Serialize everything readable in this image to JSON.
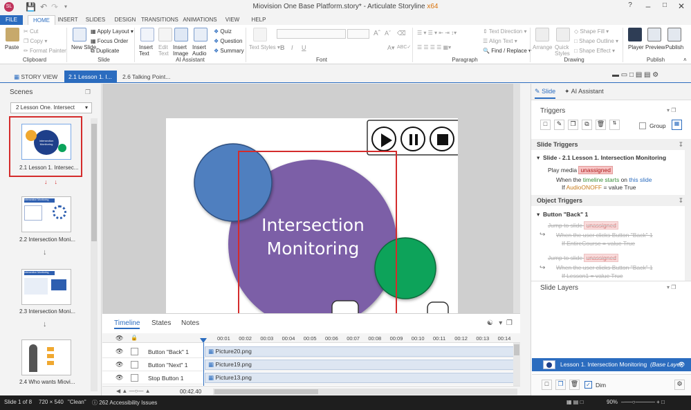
{
  "window": {
    "title_prefix": "Miovision One Base Platform.story* - Articulate Storyline",
    "title_arch": "x64"
  },
  "menu_tabs": [
    "FILE",
    "HOME",
    "INSERT",
    "SLIDES",
    "DESIGN",
    "TRANSITIONS",
    "ANIMATIONS",
    "VIEW",
    "HELP"
  ],
  "ribbon": {
    "clipboard": {
      "paste": "Paste",
      "cut": "Cut",
      "copy": "Copy",
      "format_painter": "Format Painter",
      "group": "Clipboard"
    },
    "slide": {
      "new_slide": "New Slide",
      "apply_layout": "Apply Layout",
      "focus_order": "Focus Order",
      "duplicate": "Duplicate",
      "group": "Slide"
    },
    "ai": {
      "insert_text": "Insert Text",
      "edit_text": "Edit Text",
      "insert_image": "Insert Image",
      "insert_audio": "Insert Audio",
      "quiz": "Quiz",
      "question": "Question",
      "summary": "Summary",
      "group": "AI Assistant"
    },
    "font": {
      "text_styles": "Text Styles",
      "group": "Font",
      "bold": "B",
      "italic": "I",
      "underline": "U"
    },
    "paragraph": {
      "text_direction": "Text Direction",
      "align_text": "Align Text",
      "find_replace": "Find / Replace",
      "group": "Paragraph"
    },
    "drawing": {
      "arrange": "Arrange",
      "quick_styles": "Quick Styles",
      "shape_fill": "Shape Fill",
      "shape_outline": "Shape Outline",
      "shape_effect": "Shape Effect",
      "group": "Drawing"
    },
    "publish": {
      "player": "Player",
      "preview": "Preview",
      "publish": "Publish",
      "group": "Publish"
    }
  },
  "doc_tabs": {
    "story_view": "STORY VIEW",
    "active": "2.1 Lesson 1. I...",
    "other": "2.6 Talking Point..."
  },
  "scenes": {
    "title": "Scenes",
    "dropdown": "2 Lesson One. Intersect",
    "slides": [
      {
        "caption": "2.1 Lesson 1. Intersec...",
        "thumb_title": "Intersection Monitoring"
      },
      {
        "caption": "2.2 Intersection Moni...",
        "thumb_title": "Intersection Monitoring"
      },
      {
        "caption": "2.3 Intersection Moni...",
        "thumb_title": "Intersection Monitoring"
      },
      {
        "caption": "2.4 Who wants Miovi...",
        "thumb_title": ""
      }
    ]
  },
  "slide_canvas": {
    "circle_text_line1": "Intersection",
    "circle_text_line2": "Monitoring",
    "colors": {
      "purple": "#7b5ea7",
      "blue": "#4f7fbf",
      "green": "#0aa35a",
      "orange": "#f0a830",
      "highlight": "#d42b2b"
    }
  },
  "timeline": {
    "tabs": [
      "Timeline",
      "States",
      "Notes"
    ],
    "ticks": [
      "00:01",
      "00:02",
      "00:03",
      "00:04",
      "00:05",
      "00:06",
      "00:07",
      "00:08",
      "00:09",
      "00:10",
      "00:11",
      "00:12",
      "00:13",
      "00:14"
    ],
    "rows": [
      {
        "name": "Button \"Back\" 1",
        "asset": "Picture20.png"
      },
      {
        "name": "Button \"Next\" 1",
        "asset": "Picture19.png"
      },
      {
        "name": "Stop Button 1",
        "asset": "Picture13.png"
      }
    ],
    "duration": "00:42.40"
  },
  "right_panel": {
    "tabs": {
      "slide": "Slide",
      "ai": "AI Assistant"
    },
    "triggers_title": "Triggers",
    "group_label": "Group",
    "slide_triggers_title": "Slide Triggers",
    "slide_trigger_group": "Slide - 2.1 Lesson 1. Intersection Monitoring",
    "slide_trigger": {
      "action": "Play media",
      "target": "unassigned",
      "when_prefix": "When the",
      "when_event": "timeline starts",
      "when_on": "on",
      "when_target": "this slide",
      "if_prefix": "If",
      "if_var": "AudioONOFF",
      "if_cond": "= value True"
    },
    "object_triggers_title": "Object Triggers",
    "object_group": "Button \"Back\" 1",
    "object_triggers": [
      {
        "action": "Jump to slide",
        "target": "unassigned",
        "when": "When the user clicks Button \"Back\" 1",
        "cond": "If EntireCourse = value True"
      },
      {
        "action": "Jump to slide",
        "target": "unassigned",
        "when": "When the user clicks Button \"Back\" 1",
        "cond": "If Lesson1 = value True"
      }
    ],
    "slide_layers_title": "Slide Layers",
    "base_layer_name": "Lesson 1. Intersection Monitoring",
    "base_layer_tag": "(Base Layer)",
    "dim_label": "Dim"
  },
  "status": {
    "slide_of": "Slide 1 of 8",
    "dimensions": "720 × 540",
    "theme": "\"Clean\"",
    "accessibility": "262 Accessibility Issues",
    "zoom": "90%"
  }
}
